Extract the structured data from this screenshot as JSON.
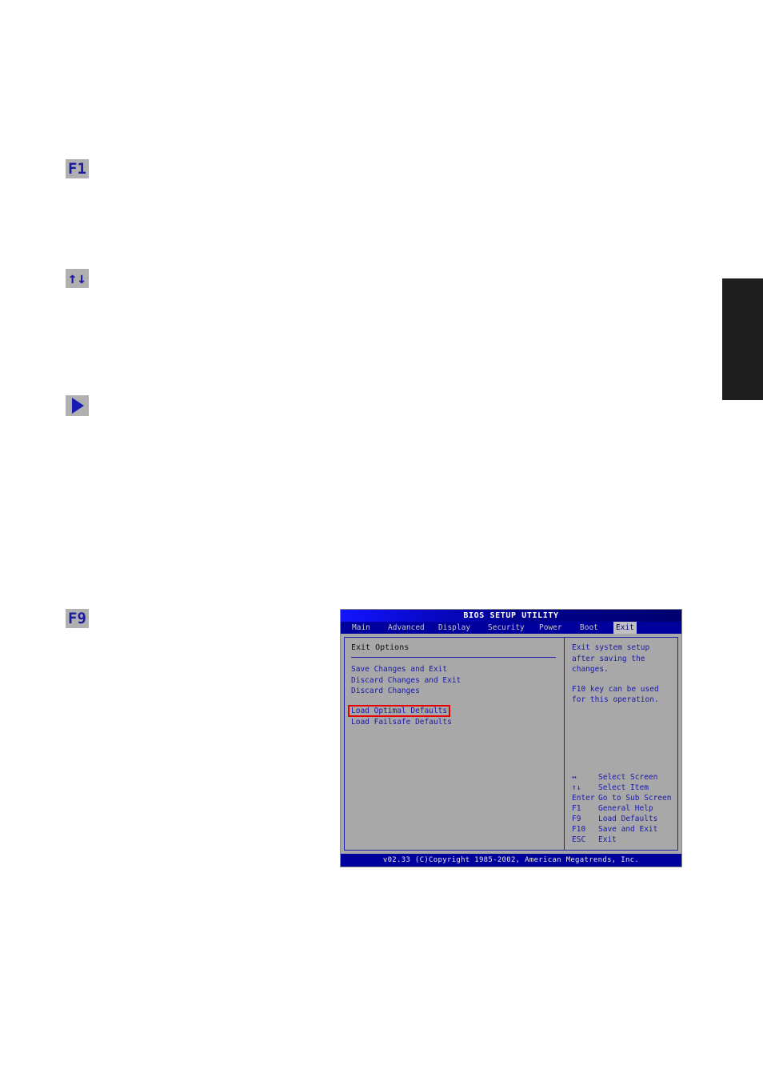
{
  "page": {
    "background": "#ffffff"
  },
  "margin_badges": [
    {
      "name": "f1",
      "label": "F1",
      "kind": "text"
    },
    {
      "name": "updown",
      "label": "↑↓",
      "kind": "text"
    },
    {
      "name": "triangle",
      "label": "",
      "kind": "triangle"
    },
    {
      "name": "f9",
      "label": "F9",
      "kind": "text"
    }
  ],
  "edge_tab": {
    "color": "#1e1e1e"
  },
  "bios": {
    "title": "BIOS SETUP UTILITY",
    "tabs": [
      {
        "label": "Main",
        "active": false
      },
      {
        "label": "Advanced",
        "active": false
      },
      {
        "label": "Display",
        "active": false
      },
      {
        "label": "Security",
        "active": false
      },
      {
        "label": "Power",
        "active": false
      },
      {
        "label": "Boot",
        "active": false
      },
      {
        "label": "Exit",
        "active": true
      }
    ],
    "left_panel": {
      "heading": "Exit Options",
      "items_group_one": [
        "Save Changes and Exit",
        "Discard Changes and Exit",
        "Discard Changes"
      ],
      "highlighted_item": "Load Optimal Defaults",
      "items_group_two": [
        "Load Failsafe Defaults"
      ],
      "highlight_color": "#e80000"
    },
    "right_panel": {
      "help_paragraph_one": [
        "Exit system setup",
        "after saving the",
        "changes."
      ],
      "help_paragraph_two": [
        "F10 key can be used",
        "for this operation."
      ],
      "legend": [
        {
          "key": "↔",
          "desc": "Select Screen"
        },
        {
          "key": "↑↓",
          "desc": "Select Item"
        },
        {
          "key": "Enter",
          "desc": "Go to Sub Screen"
        },
        {
          "key": "F1",
          "desc": "General Help"
        },
        {
          "key": "F9",
          "desc": "Load Defaults"
        },
        {
          "key": "F10",
          "desc": "Save and Exit"
        },
        {
          "key": "ESC",
          "desc": "Exit"
        }
      ]
    },
    "footer": "v02.33 (C)Copyright 1985-2002, American Megatrends, Inc."
  }
}
